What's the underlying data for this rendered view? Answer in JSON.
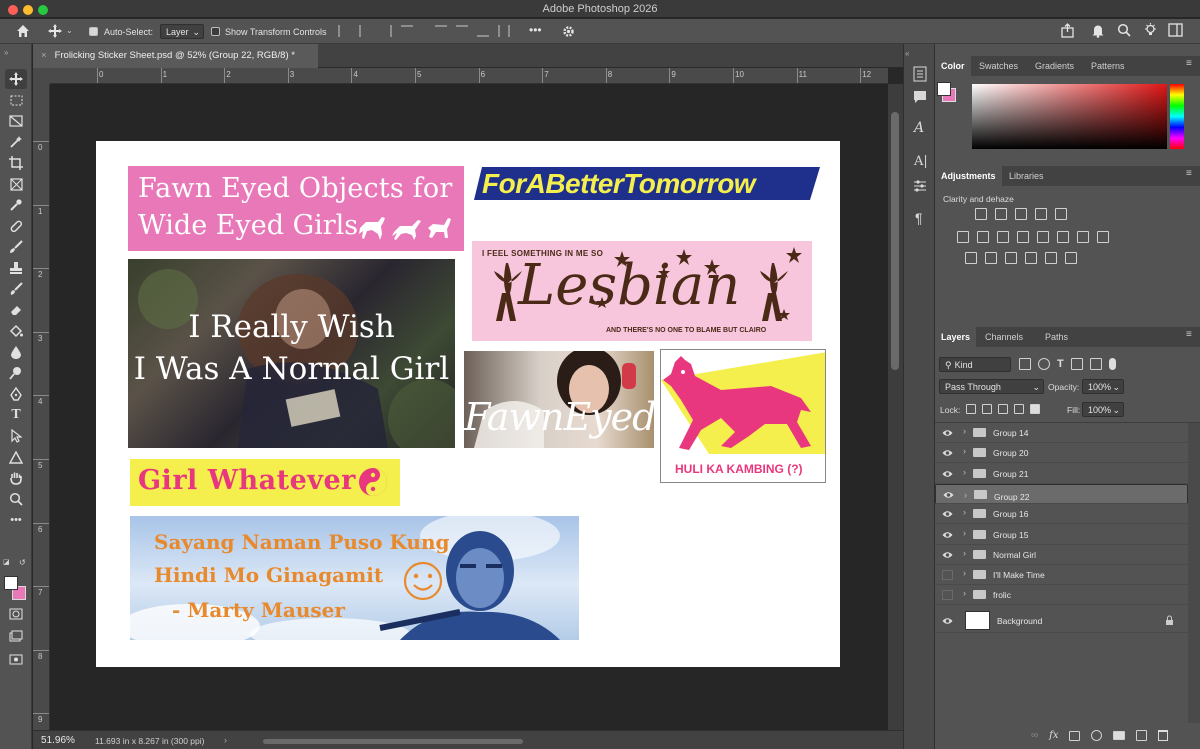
{
  "window": {
    "title": "Adobe Photoshop 2026"
  },
  "options_bar": {
    "auto_select_label": "Auto-Select:",
    "auto_select_value": "Layer",
    "show_transform_label": "Show Transform Controls",
    "more_label": "•••"
  },
  "document": {
    "tab_title": "Frolicking Sticker Sheet.psd @ 52% (Group 22, RGB/8) *",
    "close_glyph": "×"
  },
  "rulers": {
    "horizontal": [
      "0",
      "1",
      "2",
      "3",
      "4",
      "5",
      "6",
      "7",
      "8",
      "9",
      "10",
      "11",
      "12"
    ],
    "vertical": [
      "0",
      "1",
      "2",
      "3",
      "4",
      "5",
      "6",
      "7",
      "8",
      "9"
    ]
  },
  "stickers": {
    "fawn_eyed_objects": {
      "line1": "Fawn Eyed Objects for",
      "line2": "Wide Eyed Girls"
    },
    "for_a_better_tomorrow": {
      "text": "ForABetterTomorrow"
    },
    "lesbian": {
      "top": "I FEEL SOMETHING IN ME SO",
      "main": "Lesbian",
      "bottom": "AND THERE'S NO ONE TO BLAME BUT CLAIRO"
    },
    "normal_girl": {
      "line1": "I Really Wish",
      "line2": "I Was A Normal Girl"
    },
    "fawn_eyed": {
      "text": "FawnEyed"
    },
    "huli_ka_kambing": {
      "text": "HULI KA KAMBING (?)"
    },
    "girl_whatever": {
      "text": "Girl Whatever"
    },
    "sayang_naman": {
      "line1": "Sayang Naman Puso Kung",
      "line2": "Hindi Mo Ginagamit",
      "line3": "- Marty Mauser"
    }
  },
  "status_bar": {
    "zoom": "51.96%",
    "doc_info": "11.693 in x 8.267 in (300 ppi)"
  },
  "color_panel": {
    "tabs": [
      "Color",
      "Swatches",
      "Gradients",
      "Patterns"
    ],
    "active": "Color"
  },
  "adjustments_panel": {
    "tabs": [
      "Adjustments",
      "Libraries"
    ],
    "active": "Adjustments",
    "section": "Clarity and dehaze"
  },
  "layers_panel": {
    "tabs": [
      "Layers",
      "Channels",
      "Paths"
    ],
    "active": "Layers",
    "filter_label": "Kind",
    "blend_mode": "Pass Through",
    "opacity_label": "Opacity:",
    "opacity_value": "100%",
    "lock_label": "Lock:",
    "fill_label": "Fill:",
    "fill_value": "100%",
    "layers": [
      {
        "name": "Group 14",
        "visible": true,
        "type": "group",
        "selected": false
      },
      {
        "name": "Group 20",
        "visible": true,
        "type": "group",
        "selected": false
      },
      {
        "name": "Group 21",
        "visible": true,
        "type": "group",
        "selected": false
      },
      {
        "name": "Group 22",
        "visible": true,
        "type": "group",
        "selected": true
      },
      {
        "name": "Group 16",
        "visible": true,
        "type": "group",
        "selected": false
      },
      {
        "name": "Group 15",
        "visible": true,
        "type": "group",
        "selected": false
      },
      {
        "name": "Normal Girl",
        "visible": true,
        "type": "group",
        "selected": false
      },
      {
        "name": "I'll Make Time",
        "visible": false,
        "type": "group",
        "selected": false
      },
      {
        "name": "frolic",
        "visible": false,
        "type": "group",
        "selected": false
      },
      {
        "name": "Background",
        "visible": true,
        "type": "background",
        "selected": false
      }
    ]
  },
  "colors": {
    "pink": "#e878b8",
    "yellow": "#f4ef4c",
    "navy": "#1f2f8c",
    "orange": "#e8892c",
    "sticker_pink_light": "#f7c6dd",
    "deer_pink": "#e8377e"
  }
}
